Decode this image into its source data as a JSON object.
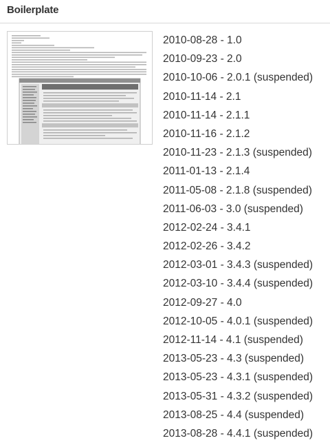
{
  "page": {
    "title": "Boilerplate"
  },
  "thumbnail": {
    "kind": "document-preview"
  },
  "versions": [
    "2010-08-28 - 1.0",
    "2010-09-23 - 2.0",
    "2010-10-06 - 2.0.1 (suspended)",
    "2010-11-14 - 2.1",
    "2010-11-14 - 2.1.1",
    "2010-11-16 - 2.1.2",
    "2010-11-23 - 2.1.3 (suspended)",
    "2011-01-13 - 2.1.4",
    "2011-05-08 - 2.1.8 (suspended)",
    "2011-06-03 - 3.0 (suspended)",
    "2012-02-24 - 3.4.1",
    "2012-02-26 - 3.4.2",
    "2012-03-01 - 3.4.3 (suspended)",
    "2012-03-10 - 3.4.4 (suspended)",
    "2012-09-27 - 4.0",
    "2012-10-05 - 4.0.1 (suspended)",
    "2012-11-14 - 4.1 (suspended)",
    "2013-05-23 - 4.3 (suspended)",
    "2013-05-23 - 4.3.1 (suspended)",
    "2013-05-31 - 4.3.2 (suspended)",
    "2013-08-25 - 4.4 (suspended)",
    "2013-08-28 - 4.4.1 (suspended)"
  ],
  "colors": {
    "text": "#333333",
    "divider": "#d9d9d9",
    "thumbnail_border": "#cfcfcf"
  }
}
